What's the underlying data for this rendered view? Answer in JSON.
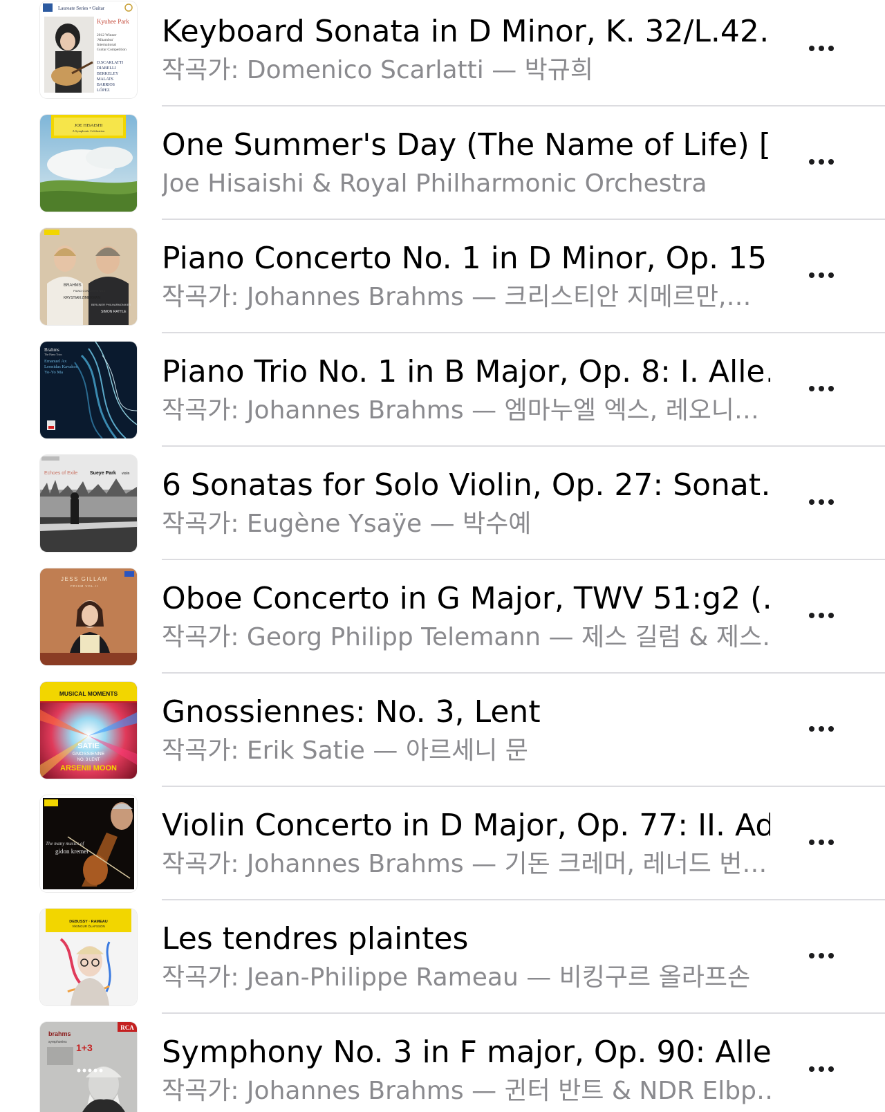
{
  "songs": [
    {
      "title": "Keyboard Sonata in D Minor, K. 32/L.42…",
      "subtitle": "작곡가: Domenico Scarlatti — 박규희",
      "art": "album-kyuhee-park"
    },
    {
      "title": "One Summer's Day (The Name of Life) […",
      "subtitle": "Joe Hisaishi & Royal Philharmonic Orchestra",
      "art": "album-joe-hisaishi"
    },
    {
      "title": "Piano Concerto No. 1 in D Minor, Op. 15…",
      "subtitle": "작곡가: Johannes Brahms — 크리스티안 지메르만,…",
      "art": "album-brahms-zimerman"
    },
    {
      "title": "Piano Trio No. 1 in B Major, Op. 8: I. Alle…",
      "subtitle": "작곡가: Johannes Brahms — 엠마누엘 엑스, 레오니…",
      "art": "album-brahms-piano-trios"
    },
    {
      "title": "6 Sonatas for Solo Violin, Op. 27: Sonat…",
      "subtitle": "작곡가: Eugène Ysaÿe — 박수예",
      "art": "album-echoes-of-exile"
    },
    {
      "title": "Oboe Concerto in G Major, TWV 51:g2 (…",
      "subtitle": "작곡가: Georg Philipp Telemann — 제스 길럼 & 제스…",
      "art": "album-jess-gillam-prism"
    },
    {
      "title": "Gnossiennes: No. 3, Lent",
      "subtitle": "작곡가: Erik Satie — 아르세니 문",
      "art": "album-musical-moments-satie"
    },
    {
      "title": "Violin Concerto in D Major, Op. 77: II. Ad…",
      "subtitle": "작곡가: Johannes Brahms — 기돈 크레머, 레너드 번…",
      "art": "album-gidon-kremer"
    },
    {
      "title": "Les tendres plaintes",
      "subtitle": "작곡가: Jean-Philippe Rameau — 비킹구르 올라프손",
      "art": "album-debussy-rameau"
    },
    {
      "title": "Symphony No. 3 in F major, Op. 90: Alle…",
      "subtitle": "작곡가: Johannes Brahms — 귄터 반트 & NDR Elbp…",
      "art": "album-brahms-symphonies"
    }
  ],
  "cover_text": {
    "kyuhee": {
      "series": "Laureate Series • Guitar",
      "name": "Kyuhee Park",
      "line1": "2012 Winner",
      "line2": "'Alhambra'",
      "line3": "International",
      "line4": "Guitar Competition",
      "composers": [
        "D.SCARLATTI",
        "DIABELLI",
        "BERKELEY",
        "MALATS",
        "BARRIOS",
        "LÓPEZ"
      ]
    },
    "hisaishi": {
      "name": "JOE HISAISHI",
      "sub": "A Symphonic Celebration"
    },
    "zimerman": {
      "line1": "BRAHMS",
      "line2": "PIANO CONCERTO NO.1",
      "line3": "KRYSTIAN ZIMERMAN",
      "line4": "BERLINER PHILHARMONIKER",
      "line5": "SIMON RATTLE"
    },
    "trio": {
      "line1": "Brahms",
      "line2": "The Piano Trios",
      "line3": "Emanuel Ax",
      "line4": "Leonidas Kavakos",
      "line5": "Yo-Yo Ma"
    },
    "exile": {
      "title": "Echoes of Exile",
      "artist": "Sueye Park",
      "instrument": "violin"
    },
    "gillam": {
      "name": "JESS GILLAM",
      "sub": "PRISM VOL.II"
    },
    "satie": {
      "header": "MUSICAL MOMENTS",
      "composer": "SATIE",
      "work": "GNOSSIENNE",
      "detail": "NO. 3 LENT",
      "artist": "ARSENII MOON"
    },
    "kremer": {
      "line1": "The many musics of",
      "line2": "gidon kremer"
    },
    "olafsson": {
      "line1": "DEBUSSY · RAMEAU",
      "line2": "VÍKINGUR ÓLAFSSON"
    },
    "brahms_sym": {
      "name": "brahms",
      "label": "RCA",
      "nums": "1+3",
      "sub": "symphonies"
    }
  },
  "colors": {
    "title": "#000000",
    "subtitle": "#8a8a8e",
    "separator": "#dcdce0",
    "more_dots": "#1c1c1e",
    "dg_yellow": "#f2d600"
  },
  "icons": {
    "more": "ellipsis-icon"
  }
}
